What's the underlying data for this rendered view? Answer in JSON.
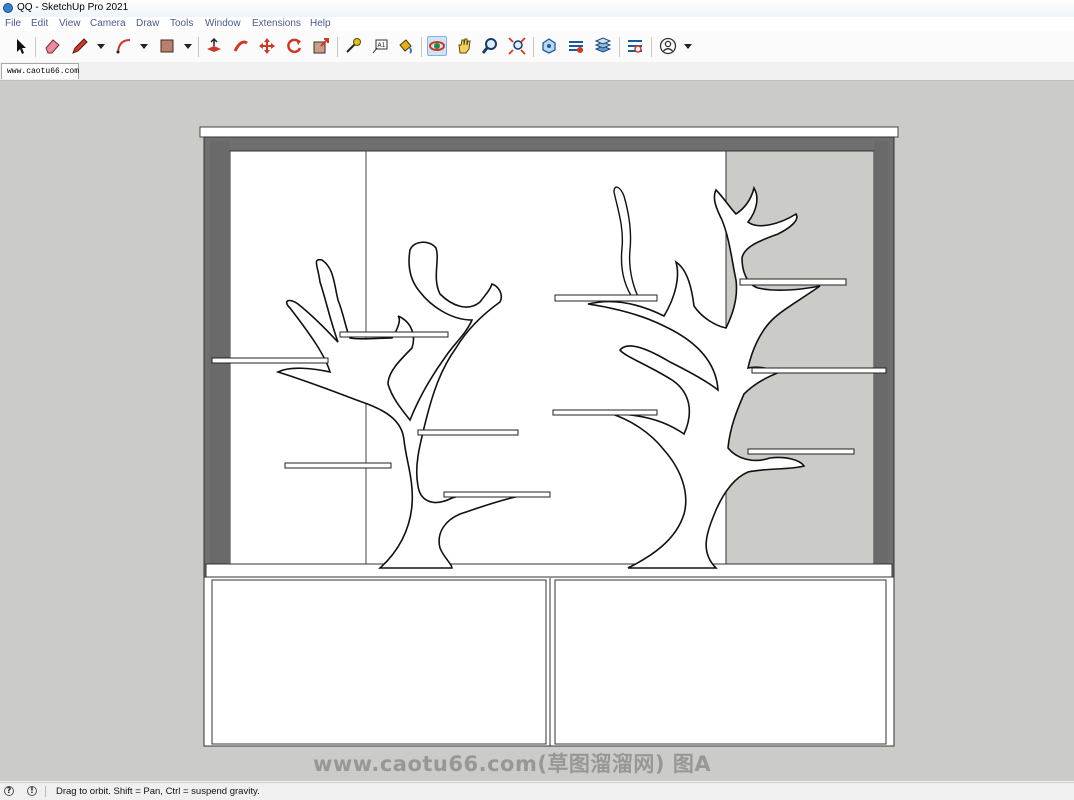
{
  "window": {
    "title": "QQ - SketchUp Pro 2021"
  },
  "menu": {
    "items": [
      "File",
      "Edit",
      "View",
      "Camera",
      "Draw",
      "Tools",
      "Window",
      "Extensions",
      "Help"
    ]
  },
  "toolbar": {
    "tools": [
      "select-icon",
      "eraser-icon",
      "pencil-line-icon",
      "arc-icon",
      "shape-icon",
      "push-pull-icon",
      "follow-me-icon",
      "move-icon",
      "rotate-icon",
      "scale-icon",
      "tape-measure-icon",
      "text-icon",
      "paint-bucket-icon",
      "orbit-icon",
      "pan-icon",
      "zoom-icon",
      "zoom-extents-icon",
      "warehouse-icon",
      "extension-warehouse-icon",
      "layout-icon",
      "extension-manager-icon",
      "account-icon"
    ]
  },
  "tabs": [
    {
      "label": "www.caotu66.com"
    }
  ],
  "status": {
    "message": "Drag to orbit. Shift = Pan, Ctrl = suspend gravity."
  },
  "watermark": {
    "text": "www.caotu66.com(草图溜溜网) 图A"
  },
  "colors": {
    "viewport_bg": "#cbcbc7",
    "cabinet_frame": "#707070",
    "model_white": "#ffffff"
  }
}
